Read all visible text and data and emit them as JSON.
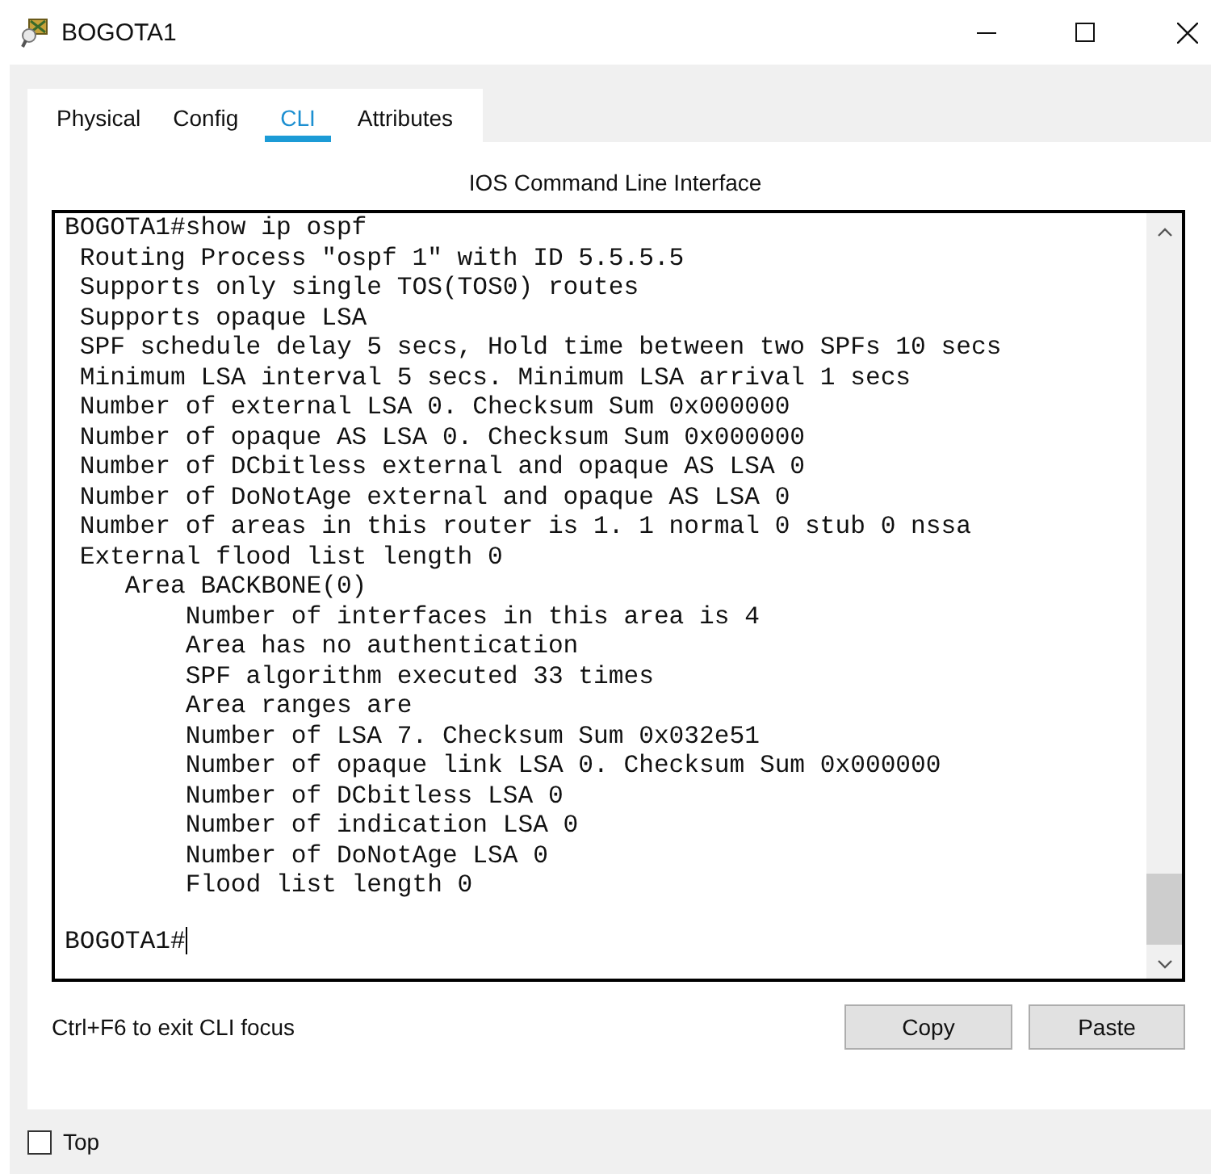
{
  "window": {
    "title": "BOGOTA1"
  },
  "tabs": [
    {
      "label": "Physical",
      "selected": false
    },
    {
      "label": "Config",
      "selected": false
    },
    {
      "label": "CLI",
      "selected": true
    },
    {
      "label": "Attributes",
      "selected": false
    }
  ],
  "panel_title": "IOS Command Line Interface",
  "terminal": {
    "lines": [
      "BOGOTA1#show ip ospf",
      " Routing Process \"ospf 1\" with ID 5.5.5.5",
      " Supports only single TOS(TOS0) routes",
      " Supports opaque LSA",
      " SPF schedule delay 5 secs, Hold time between two SPFs 10 secs",
      " Minimum LSA interval 5 secs. Minimum LSA arrival 1 secs",
      " Number of external LSA 0. Checksum Sum 0x000000",
      " Number of opaque AS LSA 0. Checksum Sum 0x000000",
      " Number of DCbitless external and opaque AS LSA 0",
      " Number of DoNotAge external and opaque AS LSA 0",
      " Number of areas in this router is 1. 1 normal 0 stub 0 nssa",
      " External flood list length 0",
      "    Area BACKBONE(0)",
      "        Number of interfaces in this area is 4",
      "        Area has no authentication",
      "        SPF algorithm executed 33 times",
      "        Area ranges are",
      "        Number of LSA 7. Checksum Sum 0x032e51",
      "        Number of opaque link LSA 0. Checksum Sum 0x000000",
      "        Number of DCbitless LSA 0",
      "        Number of indication LSA 0",
      "        Number of DoNotAge LSA 0",
      "        Flood list length 0"
    ],
    "prompt": "BOGOTA1#"
  },
  "hint": "Ctrl+F6 to exit CLI focus",
  "buttons": [
    "Copy",
    "Paste"
  ],
  "top_checkbox": {
    "label": "Top",
    "checked": false
  }
}
